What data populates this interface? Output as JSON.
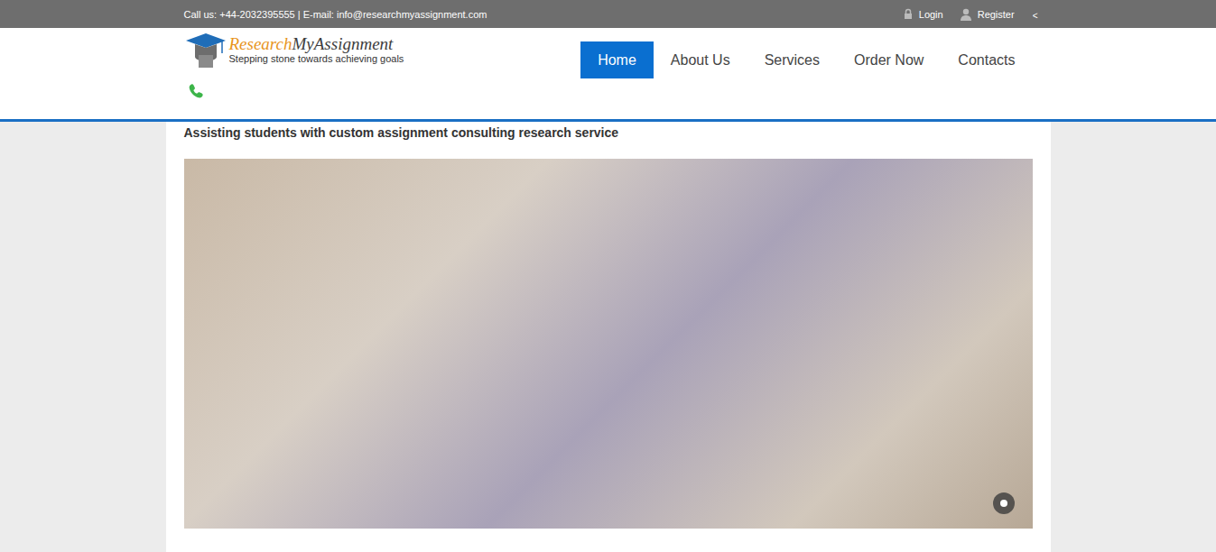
{
  "topbar": {
    "contact": "Call us: +44-2032395555 | E-mail: info@researchmyassignment.com",
    "links": [
      {
        "label": "Login"
      },
      {
        "label": "Register"
      }
    ],
    "toggle": "<"
  },
  "logo": {
    "brand_part1": "Research",
    "brand_part2": "MyAssignment",
    "tagline": "Stepping stone towards achieving goals"
  },
  "nav": [
    {
      "label": "Home",
      "selected": true
    },
    {
      "label": "About Us",
      "selected": false
    },
    {
      "label": "Services",
      "selected": false
    },
    {
      "label": "Order Now",
      "selected": false
    },
    {
      "label": "Contacts",
      "selected": false
    }
  ],
  "heading": "Assisting students with custom assignment consulting research service",
  "slider": {
    "dots": [
      {
        "selected": true
      }
    ]
  }
}
